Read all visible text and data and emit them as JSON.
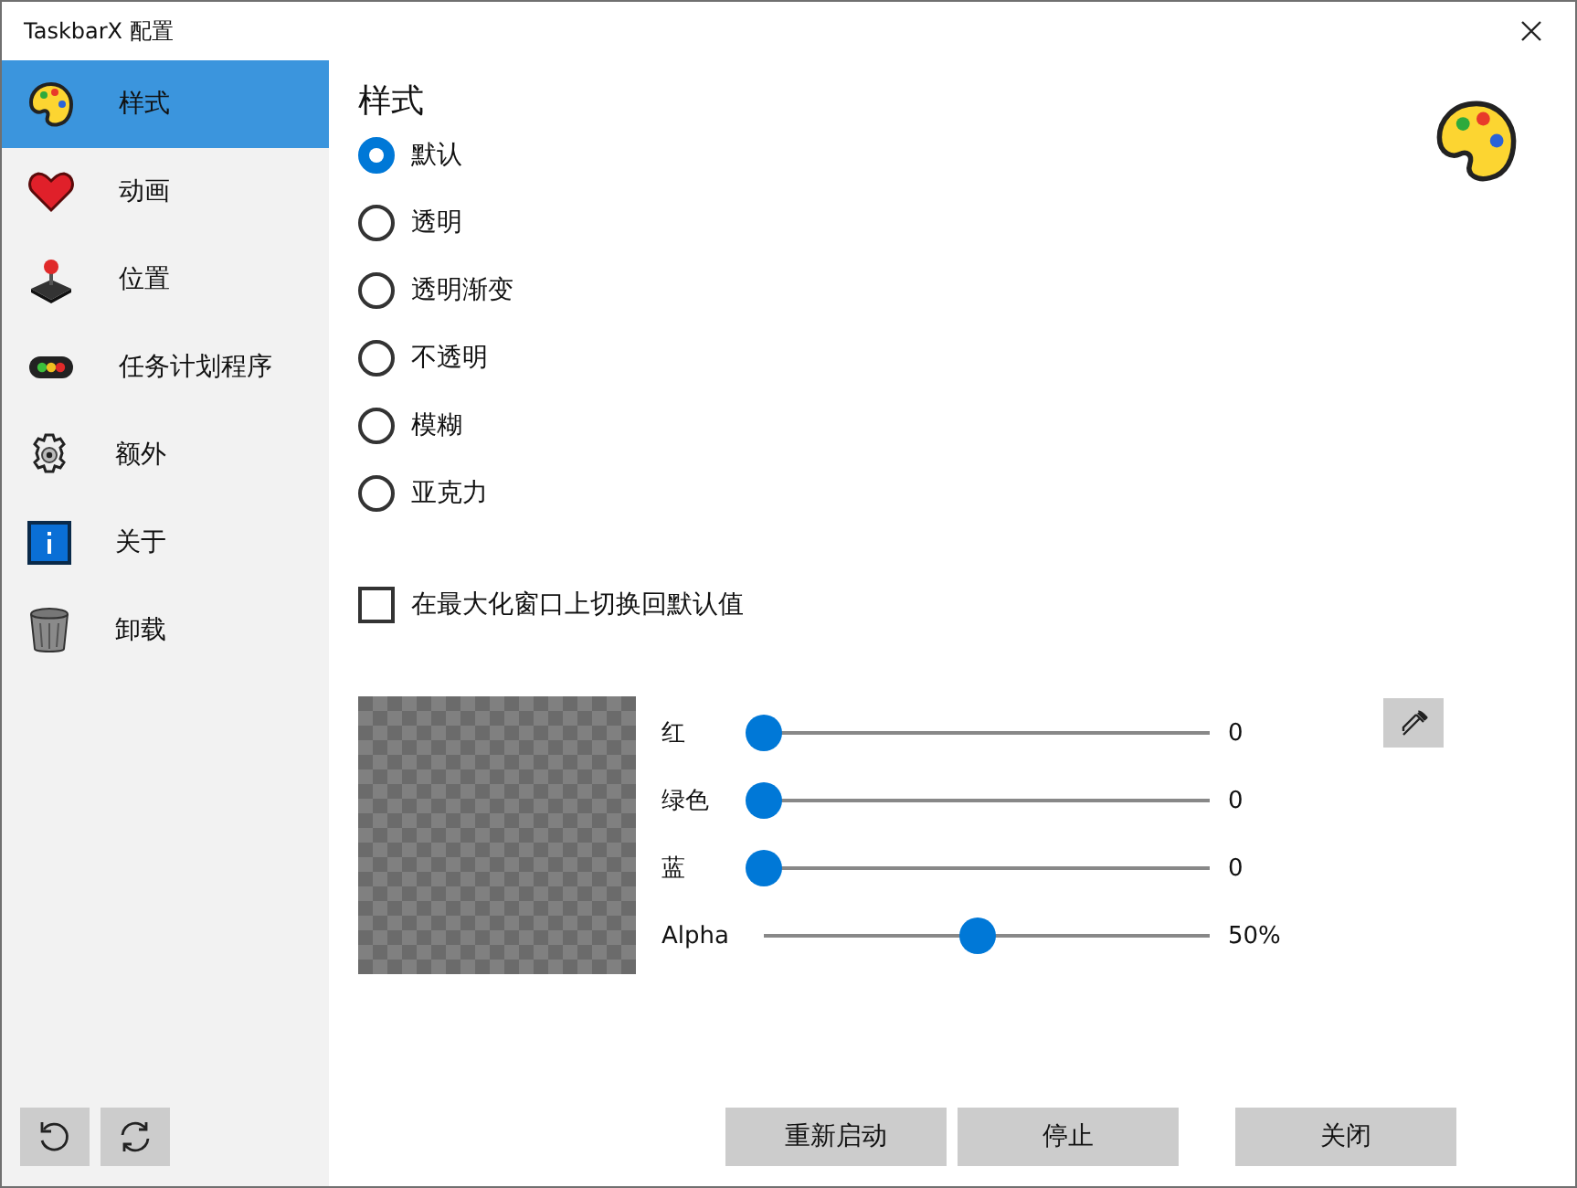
{
  "window": {
    "title": "TaskbarX 配置"
  },
  "sidebar": {
    "items": [
      {
        "label": "样式",
        "selected": true
      },
      {
        "label": "动画",
        "selected": false
      },
      {
        "label": "位置",
        "selected": false
      },
      {
        "label": "任务计划程序",
        "selected": false
      },
      {
        "label": "额外",
        "selected": false
      },
      {
        "label": "关于",
        "selected": false
      },
      {
        "label": "卸载",
        "selected": false
      }
    ]
  },
  "page": {
    "title": "样式",
    "styles": [
      {
        "label": "默认",
        "selected": true
      },
      {
        "label": "透明",
        "selected": false
      },
      {
        "label": "透明渐变",
        "selected": false
      },
      {
        "label": "不透明",
        "selected": false
      },
      {
        "label": "模糊",
        "selected": false
      },
      {
        "label": "亚克力",
        "selected": false
      }
    ],
    "revert_on_maximize": {
      "label": "在最大化窗口上切换回默认值",
      "checked": false
    },
    "sliders": [
      {
        "label": "红",
        "level": 0,
        "reading": "0"
      },
      {
        "label": "绿色",
        "level": 0,
        "reading": "0"
      },
      {
        "label": "蓝",
        "level": 0,
        "reading": "0"
      },
      {
        "label": "Alpha",
        "level": 0.5,
        "reading": "50%"
      }
    ]
  },
  "buttons": [
    "重新启动",
    "停止",
    "关闭"
  ]
}
